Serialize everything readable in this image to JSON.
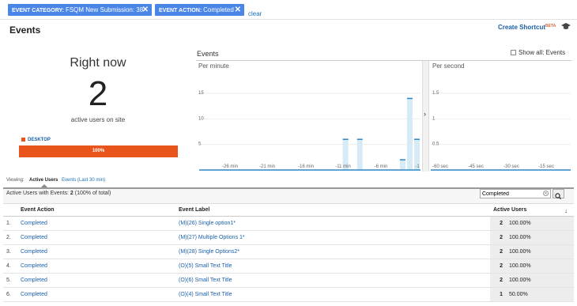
{
  "filters": [
    {
      "label": "EVENT CATEGORY:",
      "value": "FSQM New Submission: 38",
      "close": "✕"
    },
    {
      "label": "EVENT ACTION:",
      "value": "Completed",
      "close": "✕"
    }
  ],
  "clear_label": "clear",
  "page_title": "Events",
  "shortcut": {
    "label": "Create Shortcut",
    "badge": "BETA"
  },
  "right_now": {
    "title": "Right now",
    "count": "2",
    "subtitle": "active users on site"
  },
  "device": {
    "label": "DESKTOP",
    "percent_label": "100%",
    "share": 1.0,
    "color": "#e8541b"
  },
  "graph": {
    "section_label": "Events",
    "show_all_label": "Show all: Events",
    "per_minute": {
      "label": "Per minute",
      "y_ticks": [
        "15",
        "10",
        "5"
      ],
      "x_ticks": [
        "-26 min",
        "-21 min",
        "-16 min",
        "-11 min",
        "-6 min",
        "-1"
      ],
      "values": [
        0,
        0,
        0,
        0,
        0,
        0,
        0,
        0,
        0,
        0,
        0,
        0,
        0,
        0,
        0,
        0,
        0,
        0,
        0,
        0,
        6,
        0,
        6,
        0,
        0,
        0,
        0,
        0,
        2,
        14,
        6
      ]
    },
    "per_second": {
      "label": "Per second",
      "y_ticks": [
        "1.5",
        "1",
        "0.5"
      ],
      "x_ticks": [
        "-60 sec",
        "-45 sec",
        "-30 sec",
        "-15 sec"
      ]
    },
    "divider_arrow": "›"
  },
  "viewing": {
    "label": "Viewing:",
    "tabs": [
      "Active Users",
      "Events (Last 30 min)"
    ]
  },
  "table": {
    "summary_prefix": "Active Users with Events:",
    "summary_count": "2",
    "summary_pct": "(100% of total)",
    "search_value": "Completed",
    "columns": [
      "Event Action",
      "Event Label",
      "Active Users"
    ],
    "rows": [
      {
        "n": "1.",
        "action": "Completed",
        "label": "(M)(26) Single option1*",
        "users": "2",
        "pct": "100.00%"
      },
      {
        "n": "2.",
        "action": "Completed",
        "label": "(M)(27) Multiple Options 1*",
        "users": "2",
        "pct": "100.00%"
      },
      {
        "n": "3.",
        "action": "Completed",
        "label": "(M)(28) Single Options2*",
        "users": "2",
        "pct": "100.00%"
      },
      {
        "n": "4.",
        "action": "Completed",
        "label": "(O)(5) Small Text Title",
        "users": "2",
        "pct": "100.00%"
      },
      {
        "n": "5.",
        "action": "Completed",
        "label": "(O)(6) Small Text Title",
        "users": "2",
        "pct": "100.00%"
      },
      {
        "n": "6.",
        "action": "Completed",
        "label": "(O)(4) Small Text Title",
        "users": "1",
        "pct": "50.00%"
      }
    ]
  }
}
